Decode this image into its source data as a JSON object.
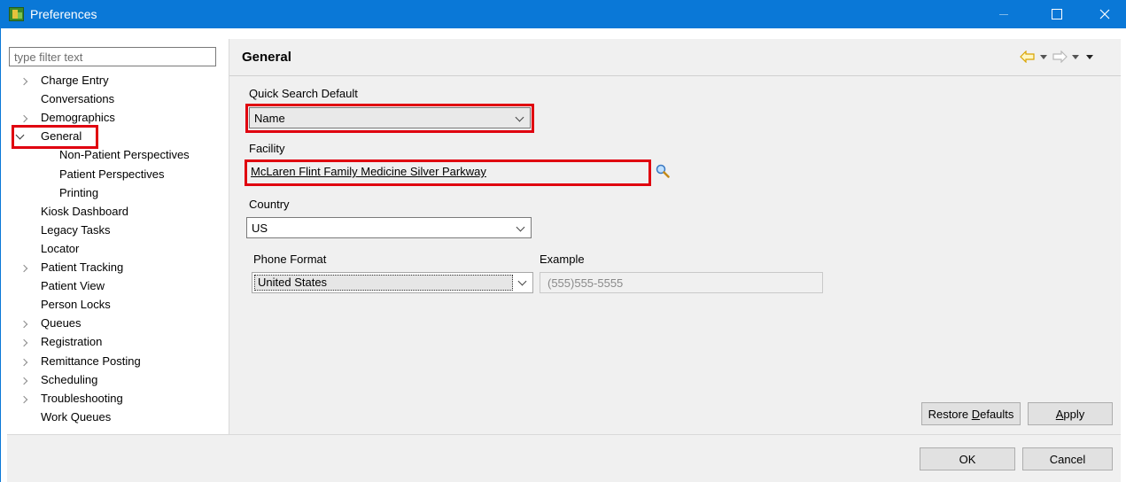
{
  "window": {
    "title": "Preferences"
  },
  "filter": {
    "placeholder": "type filter text"
  },
  "tree": {
    "items": [
      {
        "label": "Charge Entry",
        "twisty": "collapsed",
        "indent": 0
      },
      {
        "label": "Conversations",
        "twisty": "none",
        "indent": 0
      },
      {
        "label": "Demographics",
        "twisty": "collapsed",
        "indent": 0
      },
      {
        "label": "General",
        "twisty": "expanded",
        "indent": 0
      },
      {
        "label": "Non-Patient Perspectives",
        "twisty": "none",
        "indent": 1
      },
      {
        "label": "Patient Perspectives",
        "twisty": "none",
        "indent": 1
      },
      {
        "label": "Printing",
        "twisty": "none",
        "indent": 1
      },
      {
        "label": "Kiosk Dashboard",
        "twisty": "none",
        "indent": 0
      },
      {
        "label": "Legacy Tasks",
        "twisty": "none",
        "indent": 0
      },
      {
        "label": "Locator",
        "twisty": "none",
        "indent": 0
      },
      {
        "label": "Patient Tracking",
        "twisty": "collapsed",
        "indent": 0
      },
      {
        "label": "Patient View",
        "twisty": "none",
        "indent": 0
      },
      {
        "label": "Person Locks",
        "twisty": "none",
        "indent": 0
      },
      {
        "label": "Queues",
        "twisty": "collapsed",
        "indent": 0
      },
      {
        "label": "Registration",
        "twisty": "collapsed",
        "indent": 0
      },
      {
        "label": "Remittance Posting",
        "twisty": "collapsed",
        "indent": 0
      },
      {
        "label": "Scheduling",
        "twisty": "collapsed",
        "indent": 0
      },
      {
        "label": "Troubleshooting",
        "twisty": "collapsed",
        "indent": 0
      },
      {
        "label": "Work Queues",
        "twisty": "none",
        "indent": 0
      }
    ]
  },
  "page": {
    "title": "General",
    "quick_search_label": "Quick Search Default",
    "quick_search_value": "Name",
    "facility_label": "Facility",
    "facility_value": "McLaren Flint Family Medicine Silver Parkway",
    "country_label": "Country",
    "country_value": "US",
    "phone_format_label": "Phone Format",
    "phone_format_value": "United States",
    "example_label": "Example",
    "example_value": "(555)555-5555"
  },
  "buttons": {
    "restore_defaults_pre": "Restore ",
    "restore_defaults_ul": "D",
    "restore_defaults_post": "efaults",
    "apply_ul": "A",
    "apply_post": "pply",
    "ok": "OK",
    "cancel": "Cancel"
  },
  "colors": {
    "titlebar": "#0a78d7",
    "highlight": "#e0000f",
    "panel_bg": "#f0f0f0"
  }
}
